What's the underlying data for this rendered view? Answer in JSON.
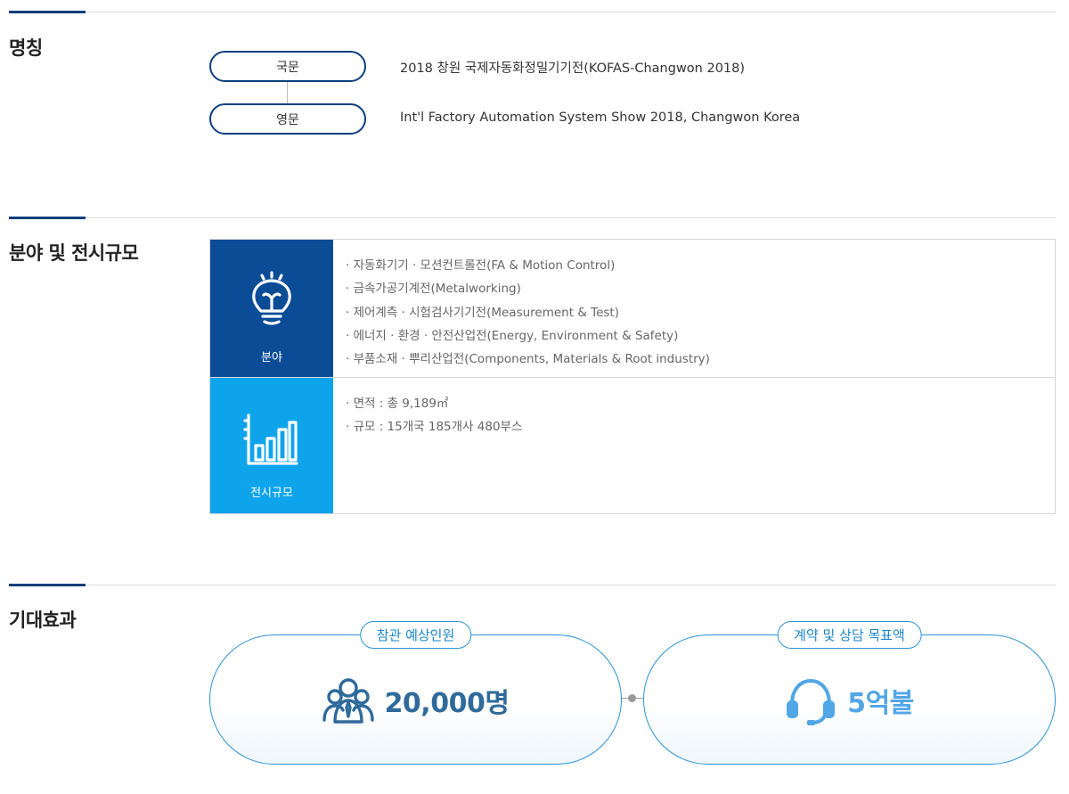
{
  "sections": {
    "name": {
      "title": "명칭",
      "korean": {
        "label": "국문",
        "text": "2018 창원 국제자동화정밀기기전(KOFAS-Changwon 2018)"
      },
      "english": {
        "label": "영문",
        "text": "Int'l Factory Automation System Show 2018, Changwon Korea"
      }
    },
    "fields": {
      "title": "분야 및 전시규모",
      "field": {
        "label": "분야",
        "icon": "lightbulb-icon",
        "items": [
          "· 자동화기기 · 모션컨트롤전(FA & Motion Control)",
          "· 금속가공기계전(Metalworking)",
          "· 제어계측 · 시험검사기기전(Measurement & Test)",
          "· 에너지 · 환경 · 안전산업전(Energy, Environment & Safety)",
          "· 부품소재 · 뿌리산업전(Components, Materials & Root industry)"
        ]
      },
      "scale": {
        "label": "전시규모",
        "icon": "bar-chart-icon",
        "items": [
          "· 면적 : 총 9,189㎡",
          "· 규모 : 15개국 185개사 480부스"
        ]
      }
    },
    "effects": {
      "title": "기대효과",
      "visitors": {
        "tag": "참관 예상인원",
        "value": "20,000명",
        "icon": "people-icon"
      },
      "contracts": {
        "tag": "계약 및 상담 목표액",
        "value": "5억불",
        "icon": "headset-icon"
      }
    }
  },
  "colors": {
    "navy": "#0e3f7e",
    "field_header": "#0b4c97",
    "scale_header": "#0ea4ec",
    "effect_border": "#2a93d5"
  }
}
